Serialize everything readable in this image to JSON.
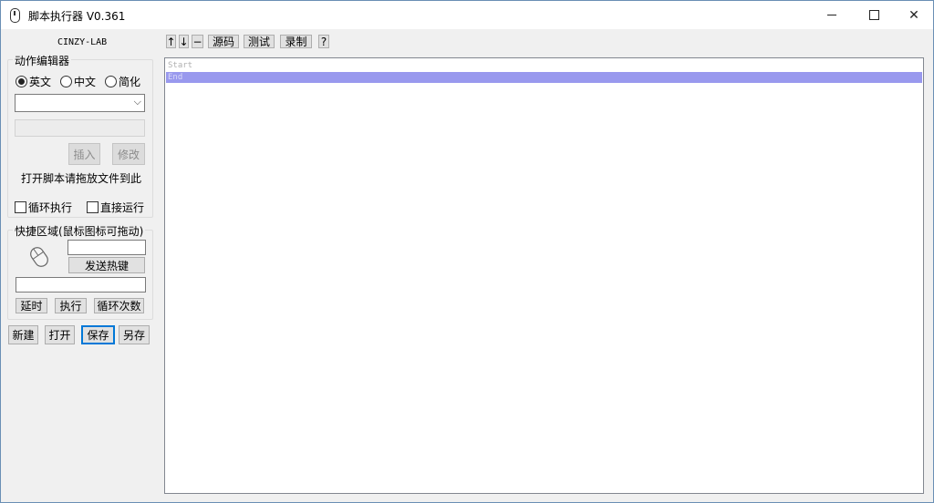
{
  "window": {
    "title": "脚本执行器 V0.361",
    "controls": [
      "minimize",
      "maximize",
      "close"
    ],
    "icons": {
      "app": "mouse-icon",
      "close_glyph": "✕"
    }
  },
  "left": {
    "brand": "CINZY-LAB",
    "action_editor": {
      "legend": "动作编辑器",
      "languages": [
        {
          "label": "英文",
          "selected": true
        },
        {
          "label": "中文",
          "selected": false
        },
        {
          "label": "简化",
          "selected": false
        }
      ],
      "select_value": "",
      "select_chevron": "⌵",
      "param_value": "",
      "insert_label": "插入",
      "modify_label": "修改",
      "hint": "打开脚本请拖放文件到此",
      "loop_label": "循环执行",
      "direct_label": "直接运行",
      "loop_checked": false,
      "direct_checked": false
    },
    "quick_area": {
      "legend": "快捷区域(鼠标图标可拖动)",
      "hotkey_value": "",
      "send_hotkey_label": "发送热键",
      "command_value": "",
      "delay_label": "延时",
      "execute_label": "执行",
      "loop_count_label": "循环次数"
    },
    "file_buttons": {
      "new": "新建",
      "open": "打开",
      "save": "保存",
      "save_as": "另存"
    }
  },
  "toolbar": {
    "up": "↑",
    "down": "↓",
    "minus": "−",
    "source": "源码",
    "test": "测试",
    "record": "录制",
    "help": "?"
  },
  "editor": {
    "lines": [
      "Start",
      "End"
    ],
    "selected_line": 1,
    "selection_color": "#9999ee"
  },
  "colors": {
    "accent": "#0078d7",
    "window_bg": "#f0f0f0"
  }
}
